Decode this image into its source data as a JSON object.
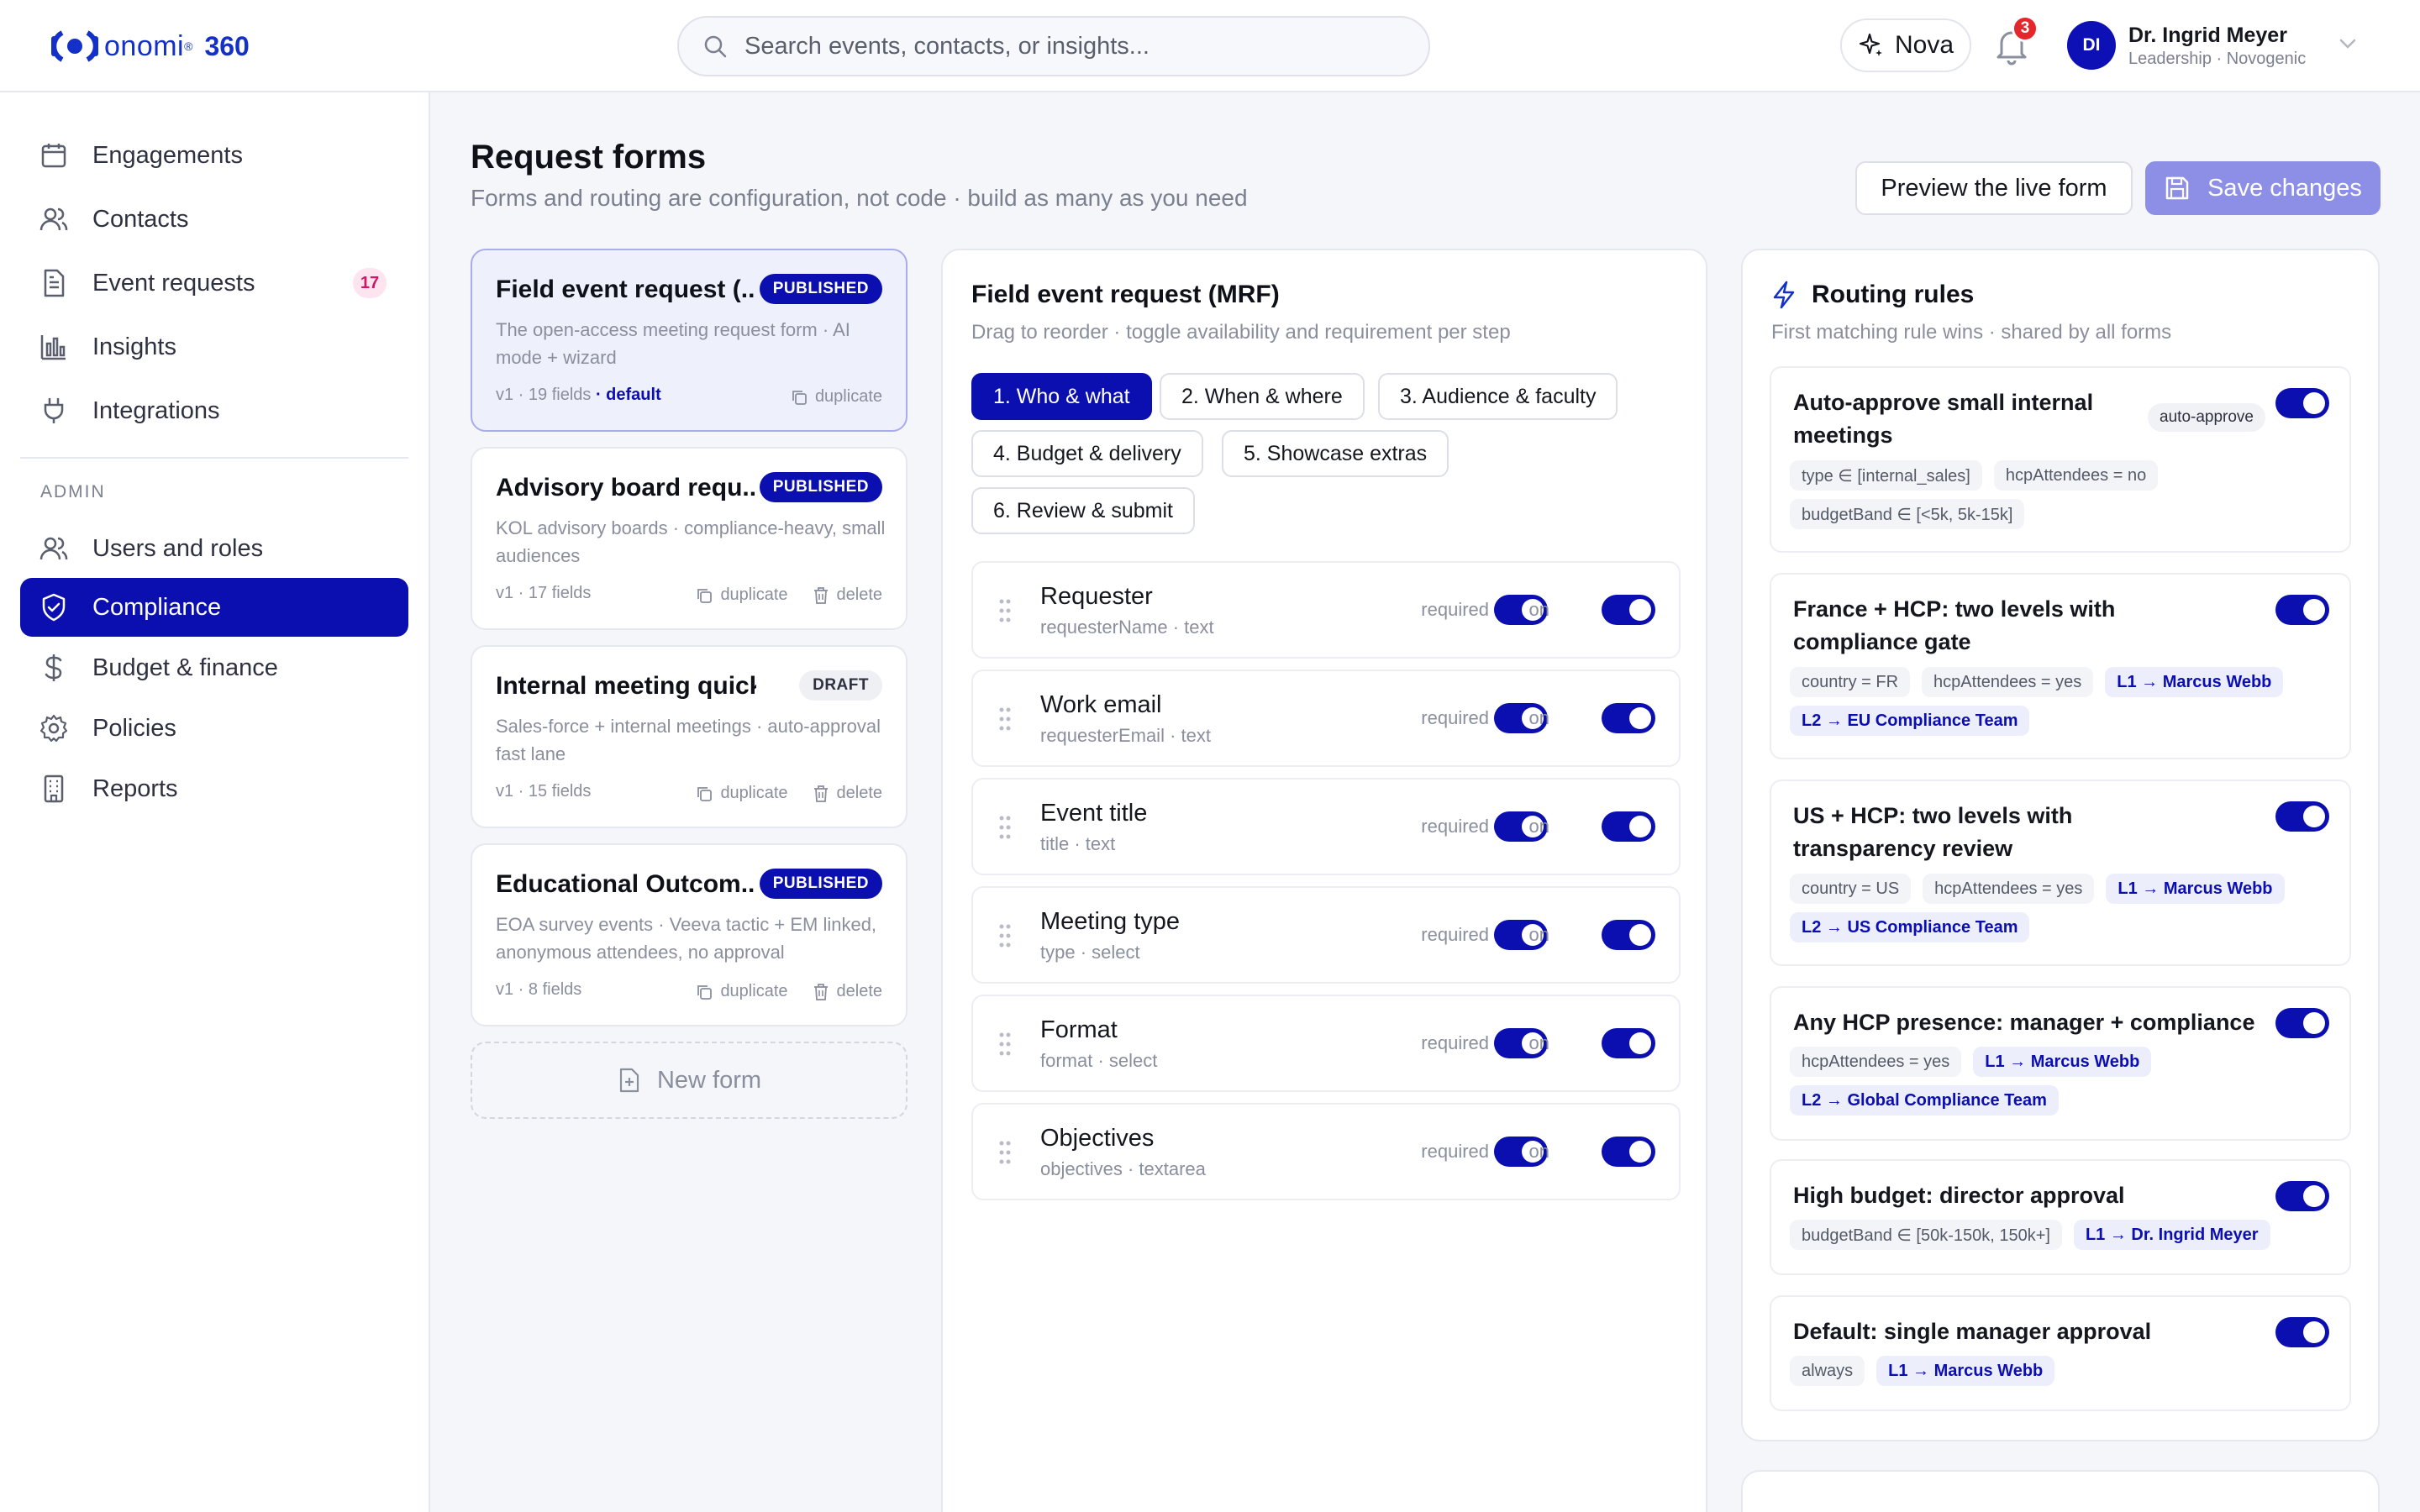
{
  "app": {
    "logo_word": "onomi",
    "logo_suffix": "360",
    "brand_color": "#1330c8",
    "accent_color": "#0b0fb0"
  },
  "search": {
    "placeholder": "Search events, contacts, or insights..."
  },
  "header": {
    "nova_label": "Nova",
    "notification_count": "3",
    "user_initials": "DI",
    "user_name": "Dr. Ingrid Meyer",
    "user_role": "Leadership · Novogenic"
  },
  "sidebar": {
    "items": [
      {
        "label": "Engagements",
        "icon": "calendar-icon"
      },
      {
        "label": "Contacts",
        "icon": "users-icon"
      },
      {
        "label": "Event requests",
        "icon": "document-icon",
        "badge": "17"
      },
      {
        "label": "Insights",
        "icon": "bar-chart-icon"
      },
      {
        "label": "Integrations",
        "icon": "plug-icon"
      }
    ],
    "admin_label": "ADMIN",
    "admin_items": [
      {
        "label": "Users and roles",
        "icon": "users-icon"
      },
      {
        "label": "Compliance",
        "icon": "shield-icon",
        "active": true
      },
      {
        "label": "Budget & finance",
        "icon": "dollar-icon"
      },
      {
        "label": "Policies",
        "icon": "gear-icon"
      },
      {
        "label": "Reports",
        "icon": "building-icon"
      }
    ]
  },
  "page": {
    "title": "Request forms",
    "subtitle": "Forms and routing are configuration, not code · build as many as you need",
    "preview_label": "Preview the live form",
    "save_label": "Save changes"
  },
  "forms": [
    {
      "title": "Field event request (...",
      "status": "PUBLISHED",
      "desc": "The open-access meeting request form · AI mode + wizard",
      "meta": "v1 · 19 fields",
      "default_label": "· default",
      "duplicate": "duplicate"
    },
    {
      "title": "Advisory board requ...",
      "status": "PUBLISHED",
      "desc": "KOL advisory boards · compliance-heavy, small audiences",
      "meta": "v1 · 17 fields",
      "duplicate": "duplicate",
      "delete": "delete"
    },
    {
      "title": "Internal meeting quick f...",
      "status": "DRAFT",
      "desc": "Sales-force + internal meetings · auto-approval fast lane",
      "meta": "v1 · 15 fields",
      "duplicate": "duplicate",
      "delete": "delete"
    },
    {
      "title": "Educational Outcom...",
      "status": "PUBLISHED",
      "desc": "EOA survey events · Veeva tactic + EM linked, anonymous attendees, no approval",
      "meta": "v1 · 8 fields",
      "duplicate": "duplicate",
      "delete": "delete"
    }
  ],
  "new_form_label": "New form",
  "editor": {
    "title": "Field event request (MRF)",
    "subtitle": "Drag to reorder · toggle availability and requirement per step",
    "steps": [
      "1. Who & what",
      "2. When & where",
      "3. Audience & faculty",
      "4. Budget & delivery",
      "5. Showcase extras",
      "6. Review & submit"
    ],
    "required_label": "required",
    "on_label": "on",
    "fields": [
      {
        "name": "Requester",
        "meta": "requesterName · text",
        "required": true,
        "on": true
      },
      {
        "name": "Work email",
        "meta": "requesterEmail · text",
        "required": true,
        "on": true
      },
      {
        "name": "Event title",
        "meta": "title · text",
        "required": true,
        "on": true
      },
      {
        "name": "Meeting type",
        "meta": "type · select",
        "required": true,
        "on": true
      },
      {
        "name": "Format",
        "meta": "format · select",
        "required": true,
        "on": true
      },
      {
        "name": "Objectives",
        "meta": "objectives · textarea",
        "required": true,
        "on": true
      }
    ]
  },
  "routing": {
    "title": "Routing rules",
    "subtitle": "First matching rule wins · shared by all forms",
    "rules": [
      {
        "name": "Auto-approve small internal meetings",
        "tag": "auto-approve",
        "enabled": true,
        "conditions": [
          "type ∈ [internal_sales]",
          "hcpAttendees = no",
          "budgetBand ∈ [<5k, 5k-15k]"
        ],
        "routes": []
      },
      {
        "name": "France + HCP: two levels with compliance gate",
        "enabled": true,
        "conditions": [
          "country = FR",
          "hcpAttendees = yes"
        ],
        "routes": [
          "L1 → Marcus Webb",
          "L2 → EU Compliance Team"
        ]
      },
      {
        "name": "US + HCP: two levels with transparency review",
        "enabled": true,
        "conditions": [
          "country = US",
          "hcpAttendees = yes"
        ],
        "routes": [
          "L1 → Marcus Webb",
          "L2 → US Compliance Team"
        ]
      },
      {
        "name": "Any HCP presence: manager + compliance",
        "enabled": true,
        "conditions": [
          "hcpAttendees = yes"
        ],
        "routes": [
          "L1 → Marcus Webb",
          "L2 → Global Compliance Team"
        ]
      },
      {
        "name": "High budget: director approval",
        "enabled": true,
        "conditions": [
          "budgetBand ∈ [50k-150k, 150k+]"
        ],
        "routes": [
          "L1 → Dr. Ingrid Meyer"
        ]
      },
      {
        "name": "Default: single manager approval",
        "enabled": true,
        "conditions": [
          "always"
        ],
        "routes": [
          "L1 → Marcus Webb"
        ]
      }
    ]
  }
}
